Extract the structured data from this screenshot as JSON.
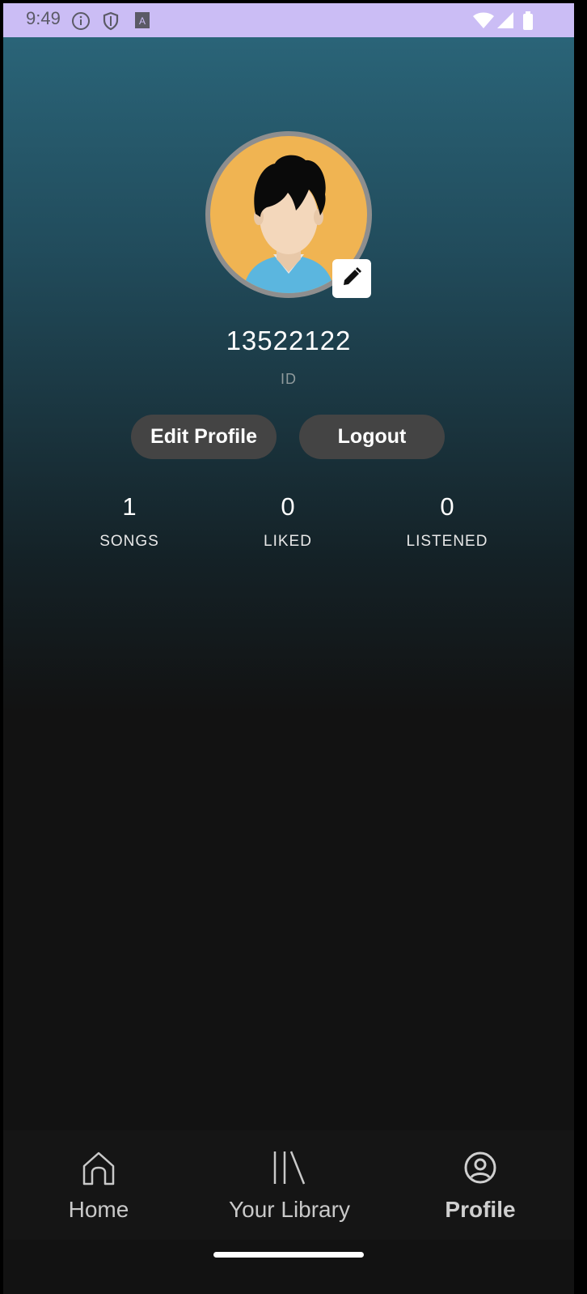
{
  "status_bar": {
    "time": "9:49",
    "left_icons": [
      "info-icon",
      "shield-icon",
      "font-icon"
    ],
    "right_icons": [
      "wifi-icon",
      "signal-icon",
      "battery-icon"
    ],
    "color": "#cbbdf5"
  },
  "profile": {
    "username": "13522122",
    "id_label": "ID",
    "avatar_bg": "#f0b452"
  },
  "actions": {
    "edit_profile": "Edit Profile",
    "logout": "Logout"
  },
  "stats": [
    {
      "value": "1",
      "label": "SONGS"
    },
    {
      "value": "0",
      "label": "LIKED"
    },
    {
      "value": "0",
      "label": "LISTENED"
    }
  ],
  "bottom_nav": {
    "items": [
      {
        "label": "Home",
        "icon": "home-icon",
        "active": false
      },
      {
        "label": "Your Library",
        "icon": "library-icon",
        "active": false
      },
      {
        "label": "Profile",
        "icon": "profile-icon",
        "active": true
      }
    ]
  }
}
